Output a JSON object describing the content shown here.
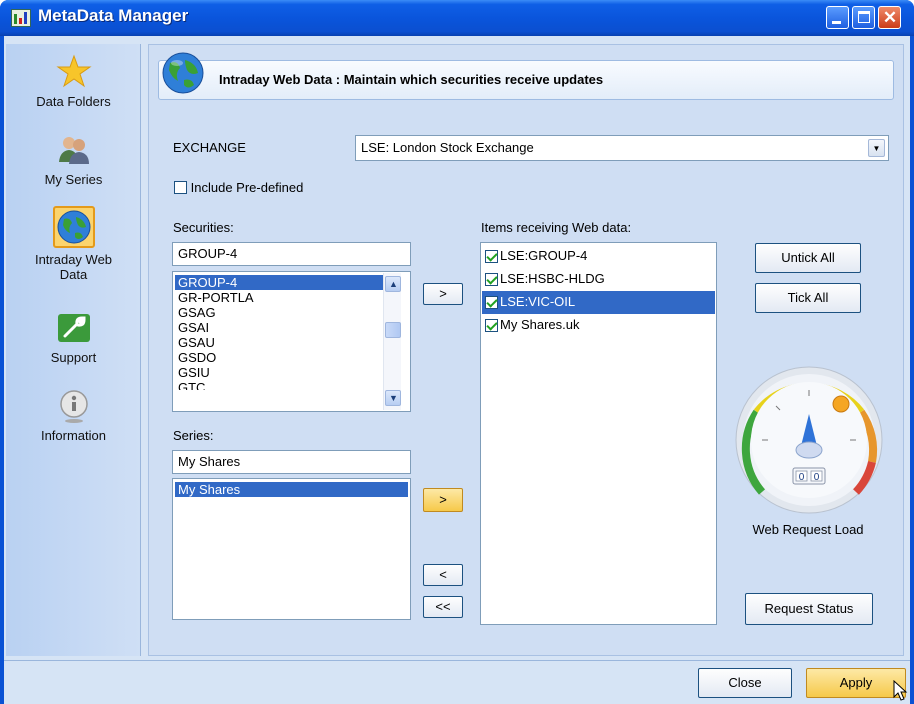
{
  "window": {
    "title": "MetaData Manager"
  },
  "sidebar": {
    "items": [
      {
        "label": "Data Folders",
        "icon": "star-icon"
      },
      {
        "label": "My Series",
        "icon": "users-icon"
      },
      {
        "label": "Intraday Web Data",
        "icon": "globe-icon",
        "active": true
      },
      {
        "label": "Support",
        "icon": "wrench-icon"
      },
      {
        "label": "Information",
        "icon": "info-icon"
      }
    ]
  },
  "header": {
    "text": "Intraday Web Data : Maintain which securities receive updates"
  },
  "exchange": {
    "label": "EXCHANGE",
    "selected": "LSE: London Stock Exchange"
  },
  "include_predefined": {
    "label": "Include Pre-defined",
    "checked": false
  },
  "securities": {
    "label": "Securities:",
    "search_value": "GROUP-4",
    "items": [
      "GROUP-4",
      "GR-PORTLA",
      "GSAG",
      "GSAI",
      "GSAU",
      "GSDO",
      "GSIU",
      "GTC"
    ],
    "selected_index": 0
  },
  "series": {
    "label": "Series:",
    "search_value": "My Shares",
    "items": [
      "My Shares"
    ],
    "selected_index": 0
  },
  "web_items": {
    "label": "Items receiving Web data:",
    "items": [
      {
        "label": "LSE:GROUP-4",
        "checked": true
      },
      {
        "label": "LSE:HSBC-HLDG",
        "checked": true
      },
      {
        "label": "LSE:VIC-OIL",
        "checked": true,
        "selected": true
      },
      {
        "label": "My Shares.uk",
        "checked": true
      }
    ]
  },
  "transfer_buttons": {
    "add_security": ">",
    "add_series": ">",
    "remove": "<",
    "remove_all": "<<"
  },
  "buttons": {
    "untick_all": "Untick All",
    "tick_all": "Tick All",
    "request_status": "Request Status",
    "close": "Close",
    "apply": "Apply"
  },
  "gauge": {
    "label": "Web Request Load",
    "digits": [
      "0",
      "0"
    ],
    "level": 0.0
  },
  "colors": {
    "title_bar": "#0a55dc",
    "selection": "#3169c6",
    "panel_bg": "#cfdef3",
    "apply_button": "#f6c94a"
  }
}
